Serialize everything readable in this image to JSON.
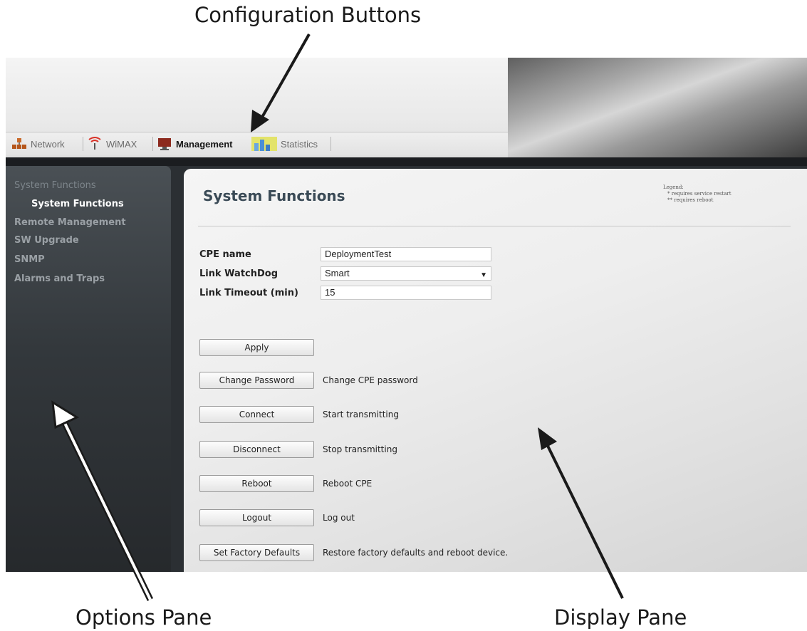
{
  "callouts": {
    "configuration_buttons": "Configuration Buttons",
    "options_pane": "Options Pane",
    "display_pane": "Display Pane"
  },
  "toolbar": {
    "tabs": [
      {
        "label": "Network",
        "icon": "network-icon",
        "active": false
      },
      {
        "label": "WiMAX",
        "icon": "wimax-antenna-icon",
        "active": false
      },
      {
        "label": "Management",
        "icon": "management-monitor-icon",
        "active": true
      },
      {
        "label": "Statistics",
        "icon": "statistics-bar-chart-icon",
        "active": false
      }
    ]
  },
  "sidebar": {
    "items": [
      {
        "label": "System Functions",
        "level": "section"
      },
      {
        "label": "System Functions",
        "level": "active"
      },
      {
        "label": "Remote Management",
        "level": "item"
      },
      {
        "label": "SW Upgrade",
        "level": "item"
      },
      {
        "label": "SNMP",
        "level": "item"
      },
      {
        "label": "Alarms and Traps",
        "level": "item"
      }
    ]
  },
  "main": {
    "title": "System Functions",
    "legend": {
      "heading": "Legend:",
      "line1": "* requires service restart",
      "line2": "** requires reboot"
    },
    "form": {
      "cpe_name_label": "CPE name",
      "cpe_name_value": "DeploymentTest",
      "link_watchdog_label": "Link WatchDog",
      "link_watchdog_value": "Smart",
      "link_timeout_label": "Link Timeout (min)",
      "link_timeout_value": "15"
    },
    "buttons": [
      {
        "label": "Apply",
        "description": ""
      },
      {
        "label": "Change Password",
        "description": "Change CPE password"
      },
      {
        "label": "Connect",
        "description": "Start transmitting"
      },
      {
        "label": "Disconnect",
        "description": "Stop transmitting"
      },
      {
        "label": "Reboot",
        "description": "Reboot CPE"
      },
      {
        "label": "Logout",
        "description": "Log out"
      },
      {
        "label": "Set Factory Defaults",
        "description": "Restore factory defaults and reboot device."
      }
    ]
  },
  "colors": {
    "sidebar_bg": "#33383c",
    "sidebar_active_text": "#ffffff",
    "title_text": "#3a4a56",
    "content_bg": "#eeeeee"
  }
}
